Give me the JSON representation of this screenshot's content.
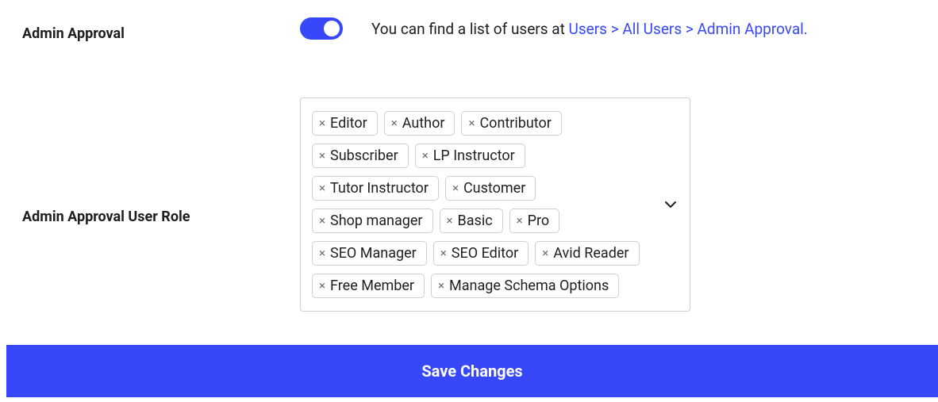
{
  "admin_approval": {
    "label": "Admin Approval",
    "enabled": true,
    "hint_prefix": "You can find a list of users at ",
    "hint_link": "Users > All Users > Admin Approval.",
    "accent_color": "#3648FA"
  },
  "admin_approval_user_role": {
    "label": "Admin Approval User Role",
    "tags": [
      "Editor",
      "Author",
      "Contributor",
      "Subscriber",
      "LP Instructor",
      "Tutor Instructor",
      "Customer",
      "Shop manager",
      "Basic",
      "Pro",
      "SEO Manager",
      "SEO Editor",
      "Avid Reader",
      "Free Member",
      "Manage Schema Options"
    ]
  },
  "save_button": {
    "label": "Save Changes"
  }
}
